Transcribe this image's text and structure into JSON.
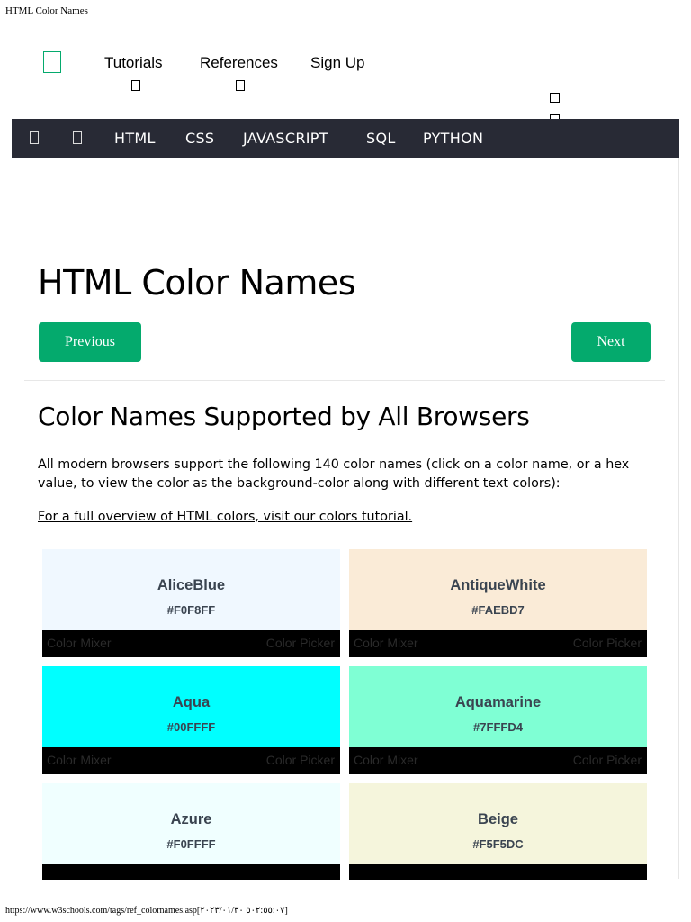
{
  "print": {
    "header": "HTML Color Names",
    "footer": "https://www.w3schools.com/tags/ref_colornames.asp[٥٠٢:٥٥:٠٧ ٢٠٢٣/٠١/٣٠]"
  },
  "topnav": {
    "tutorials": "Tutorials",
    "references": "References",
    "signup": "Sign Up"
  },
  "subnav": {
    "items": [
      "HTML",
      "CSS",
      "JAVASCRIPT",
      "SQL",
      "PYTHON"
    ]
  },
  "page": {
    "title": "HTML Color Names",
    "previous": "Previous",
    "next": "Next",
    "section_title": "Color Names Supported by All Browsers",
    "intro": "All modern browsers support the following 140 color names (click on a color name, or a hex value, to view the color as the background-color along with different text colors):",
    "overview_link": "For a full overview of HTML colors, visit our colors tutorial."
  },
  "colors": [
    {
      "name": "AliceBlue",
      "hex": "#F0F8FF",
      "mixer": "Color Mixer",
      "picker": "Color Picker"
    },
    {
      "name": "AntiqueWhite",
      "hex": "#FAEBD7",
      "mixer": "Color Mixer",
      "picker": "Color Picker"
    },
    {
      "name": "Aqua",
      "hex": "#00FFFF",
      "mixer": "Color Mixer",
      "picker": "Color Picker"
    },
    {
      "name": "Aquamarine",
      "hex": "#7FFFD4",
      "mixer": "Color Mixer",
      "picker": "Color Picker"
    },
    {
      "name": "Azure",
      "hex": "#F0FFFF"
    },
    {
      "name": "Beige",
      "hex": "#F5F5DC"
    }
  ],
  "theme": {
    "accent": "#04AA6D",
    "subnav_bg": "#282A35",
    "text": "#000000"
  },
  "icons": {
    "logo": "w3schools-logo-icon",
    "missing_glyph": "missing-glyph-icon"
  }
}
